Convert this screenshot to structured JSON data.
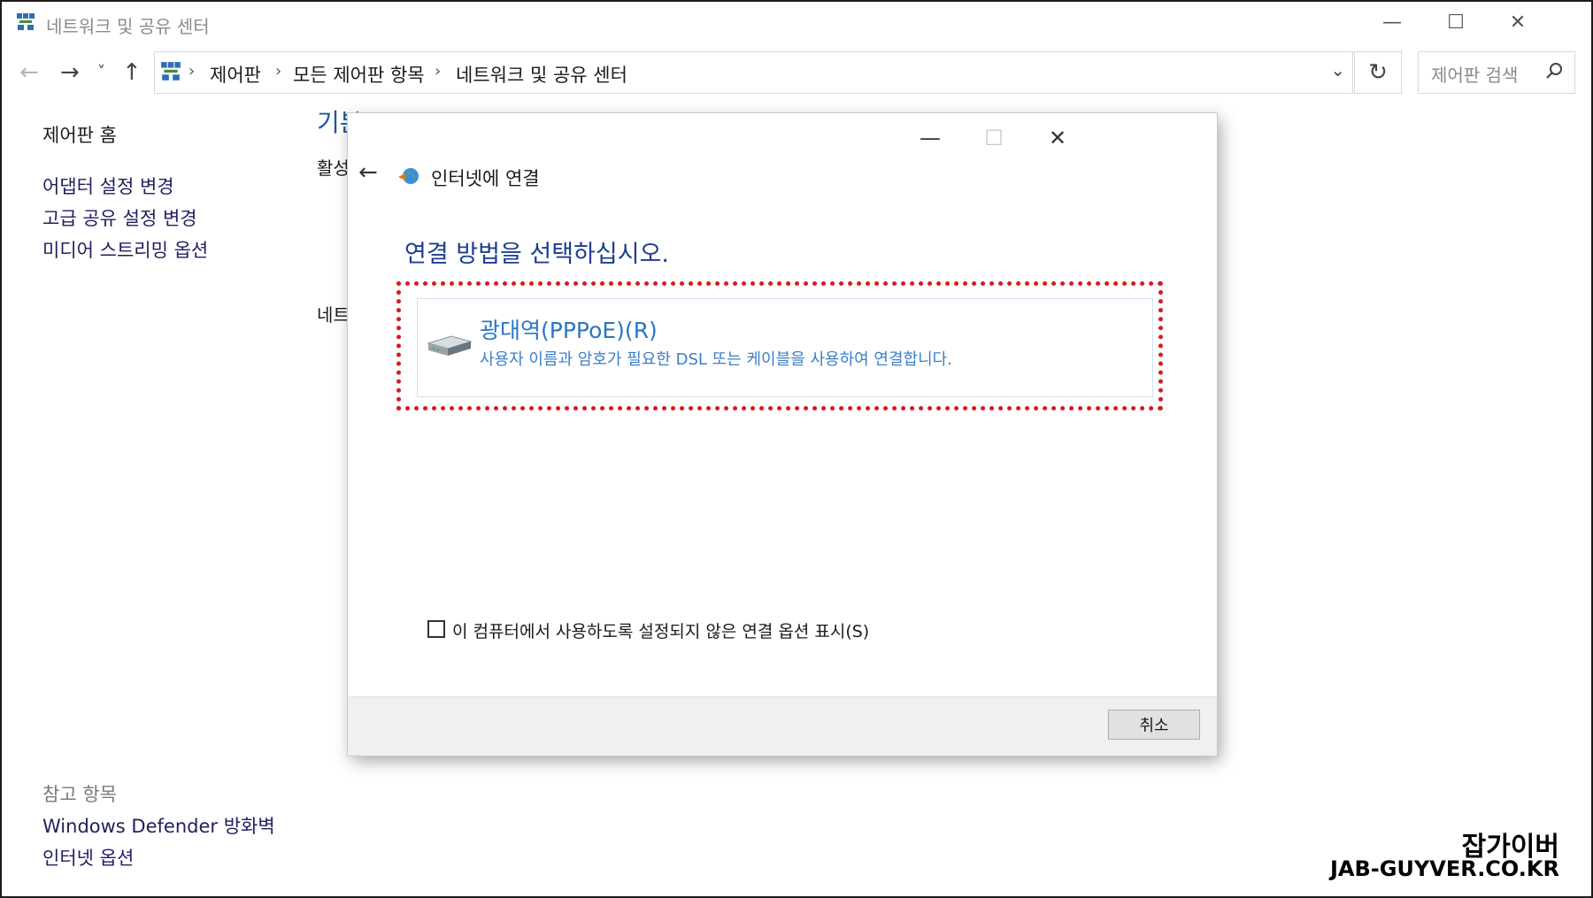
{
  "window": {
    "title": "네트워크 및 공유 센터",
    "icon": "network-icon"
  },
  "nav": {
    "back": "←",
    "forward": "→",
    "recent": "˅",
    "up": "↑",
    "breadcrumbs": [
      "제어판",
      "모든 제어판 항목",
      "네트워크 및 공유 센터"
    ],
    "separator": "›",
    "dropdown": "⌄",
    "refresh": "↻",
    "search_placeholder": "제어판 검색"
  },
  "sidebar": {
    "home": "제어판 홈",
    "items": [
      "어댑터 설정 변경",
      "고급 공유 설정 변경",
      "미디어 스트리밍 옵션"
    ],
    "see_also_title": "참고 항목",
    "see_also": [
      "Windows Defender 방화벽",
      "인터넷 옵션"
    ]
  },
  "background": {
    "title_fragment": "기본",
    "label_active": "활성",
    "label_network": "네트"
  },
  "dialog": {
    "title": "인터넷에 연결",
    "heading": "연결 방법을 선택하십시오.",
    "option": {
      "title": "광대역(PPPoE)(R)",
      "description": "사용자 이름과 암호가 필요한 DSL 또는 케이블을 사용하여 연결합니다."
    },
    "checkbox_label": "이 컴퓨터에서 사용하도록 설정되지 않은 연결 옵션 표시(S)",
    "checkbox_checked": false,
    "cancel": "취소"
  },
  "watermark": {
    "name": "잡가이버",
    "url": "JAB-GUYVER.CO.KR"
  },
  "colors": {
    "link": "#1f1f5f",
    "heading": "#1e3d8f",
    "option_text": "#2a76c6",
    "highlight": "#d81a1a"
  }
}
